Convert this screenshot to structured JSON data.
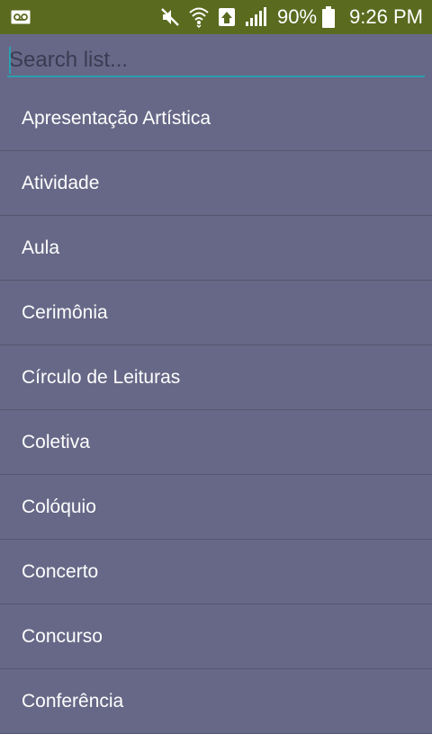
{
  "status_bar": {
    "icons": [
      "voicemail-icon",
      "mute-icon",
      "wifi-icon",
      "data-saver-icon",
      "signal-icon",
      "battery-icon"
    ],
    "battery": "90%",
    "time": "9:26 PM"
  },
  "search": {
    "placeholder": "Search list...",
    "value": ""
  },
  "list": {
    "items": [
      "Apresentação Artística",
      "Atividade",
      "Aula",
      "Cerimônia",
      "Círculo de Leituras",
      "Coletiva",
      "Colóquio",
      "Concerto",
      "Concurso",
      "Conferência"
    ]
  }
}
